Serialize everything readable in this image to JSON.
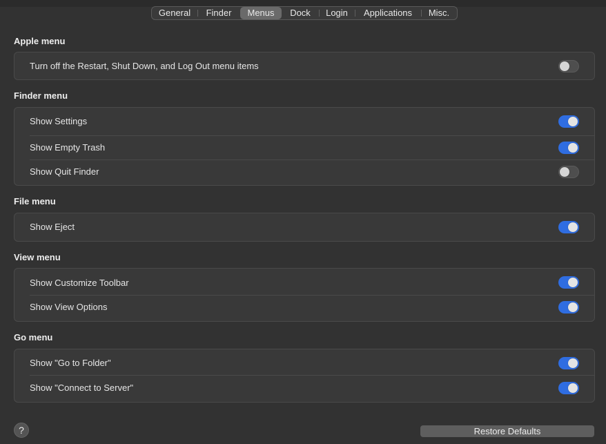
{
  "tabs": [
    {
      "label": "General",
      "active": false
    },
    {
      "label": "Finder",
      "active": false
    },
    {
      "label": "Menus",
      "active": true
    },
    {
      "label": "Dock",
      "active": false
    },
    {
      "label": "Login",
      "active": false
    },
    {
      "label": "Applications",
      "active": false
    },
    {
      "label": "Misc.",
      "active": false
    }
  ],
  "sections": [
    {
      "title": "Apple menu",
      "rows": [
        {
          "label": "Turn off the Restart, Shut Down, and Log Out menu items",
          "on": false
        }
      ]
    },
    {
      "title": "Finder menu",
      "rows": [
        {
          "label": "Show Settings",
          "on": true
        },
        {
          "label": "Show Empty Trash",
          "on": true
        },
        {
          "label": "Show Quit Finder",
          "on": false
        }
      ]
    },
    {
      "title": "File menu",
      "rows": [
        {
          "label": "Show Eject",
          "on": true
        }
      ]
    },
    {
      "title": "View menu",
      "rows": [
        {
          "label": "Show Customize Toolbar",
          "on": true
        },
        {
          "label": "Show View Options",
          "on": true
        }
      ]
    },
    {
      "title": "Go menu",
      "rows": [
        {
          "label": "Show \"Go to Folder\"",
          "on": true
        },
        {
          "label": "Show \"Connect to Server\"",
          "on": true
        }
      ]
    }
  ],
  "footer": {
    "help_label": "?",
    "restore_label": "Restore Defaults"
  },
  "colors": {
    "toggle_on": "#2f6de1",
    "background": "#323232"
  }
}
